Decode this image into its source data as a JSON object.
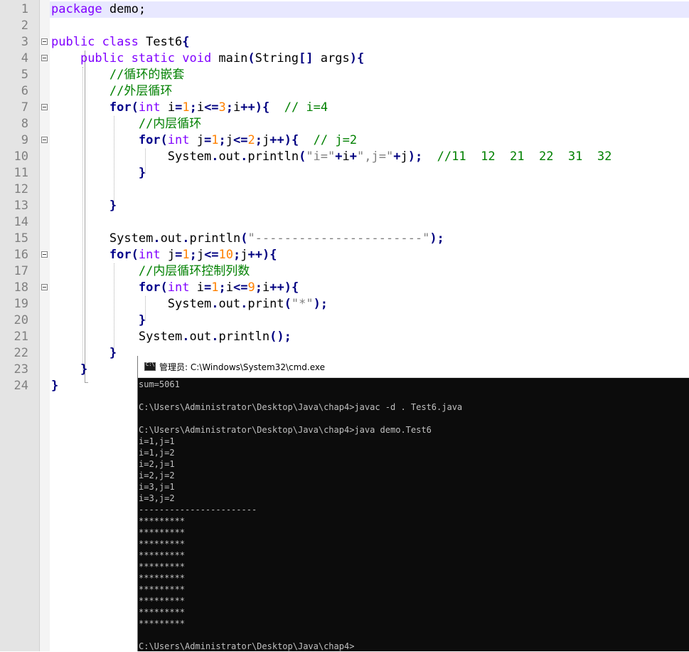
{
  "editor": {
    "lines": [
      {
        "n": "1",
        "tokens": [
          {
            "t": "package",
            "c": "kw"
          },
          {
            "t": " demo;",
            "c": "tx"
          }
        ]
      },
      {
        "n": "2",
        "tokens": []
      },
      {
        "n": "3",
        "tokens": [
          {
            "t": "public class",
            "c": "kw"
          },
          {
            "t": " Test6",
            "c": "tx"
          },
          {
            "t": "{",
            "c": "op"
          }
        ]
      },
      {
        "n": "4",
        "tokens": [
          {
            "t": "    ",
            "c": "tx"
          },
          {
            "t": "public static void",
            "c": "kw"
          },
          {
            "t": " main",
            "c": "tx"
          },
          {
            "t": "(",
            "c": "op"
          },
          {
            "t": "String",
            "c": "tx"
          },
          {
            "t": "[]",
            "c": "op"
          },
          {
            "t": " args",
            "c": "tx"
          },
          {
            "t": "){",
            "c": "op"
          }
        ]
      },
      {
        "n": "5",
        "tokens": [
          {
            "t": "        ",
            "c": "tx"
          },
          {
            "t": "//循环的嵌套",
            "c": "cm"
          }
        ]
      },
      {
        "n": "6",
        "tokens": [
          {
            "t": "        ",
            "c": "tx"
          },
          {
            "t": "//外层循环",
            "c": "cm"
          }
        ]
      },
      {
        "n": "7",
        "tokens": [
          {
            "t": "        ",
            "c": "tx"
          },
          {
            "t": "for",
            "c": "kwb"
          },
          {
            "t": "(",
            "c": "op"
          },
          {
            "t": "int",
            "c": "kw"
          },
          {
            "t": " i",
            "c": "tx"
          },
          {
            "t": "=",
            "c": "op"
          },
          {
            "t": "1",
            "c": "num"
          },
          {
            "t": ";",
            "c": "op"
          },
          {
            "t": "i",
            "c": "tx"
          },
          {
            "t": "<=",
            "c": "op"
          },
          {
            "t": "3",
            "c": "num"
          },
          {
            "t": ";",
            "c": "op"
          },
          {
            "t": "i",
            "c": "tx"
          },
          {
            "t": "++){",
            "c": "op"
          },
          {
            "t": "  ",
            "c": "tx"
          },
          {
            "t": "// i=4",
            "c": "cm"
          }
        ]
      },
      {
        "n": "8",
        "tokens": [
          {
            "t": "            ",
            "c": "tx"
          },
          {
            "t": "//内层循环",
            "c": "cm"
          }
        ]
      },
      {
        "n": "9",
        "tokens": [
          {
            "t": "            ",
            "c": "tx"
          },
          {
            "t": "for",
            "c": "kwb"
          },
          {
            "t": "(",
            "c": "op"
          },
          {
            "t": "int",
            "c": "kw"
          },
          {
            "t": " j",
            "c": "tx"
          },
          {
            "t": "=",
            "c": "op"
          },
          {
            "t": "1",
            "c": "num"
          },
          {
            "t": ";",
            "c": "op"
          },
          {
            "t": "j",
            "c": "tx"
          },
          {
            "t": "<=",
            "c": "op"
          },
          {
            "t": "2",
            "c": "num"
          },
          {
            "t": ";",
            "c": "op"
          },
          {
            "t": "j",
            "c": "tx"
          },
          {
            "t": "++){",
            "c": "op"
          },
          {
            "t": "  ",
            "c": "tx"
          },
          {
            "t": "// j=2",
            "c": "cm"
          }
        ]
      },
      {
        "n": "10",
        "tokens": [
          {
            "t": "                ",
            "c": "tx"
          },
          {
            "t": "System",
            "c": "tx"
          },
          {
            "t": ".",
            "c": "op"
          },
          {
            "t": "out",
            "c": "tx"
          },
          {
            "t": ".",
            "c": "op"
          },
          {
            "t": "println",
            "c": "tx"
          },
          {
            "t": "(",
            "c": "op"
          },
          {
            "t": "\"i=\"",
            "c": "str"
          },
          {
            "t": "+",
            "c": "op"
          },
          {
            "t": "i",
            "c": "tx"
          },
          {
            "t": "+",
            "c": "op"
          },
          {
            "t": "\",j=\"",
            "c": "str"
          },
          {
            "t": "+",
            "c": "op"
          },
          {
            "t": "j",
            "c": "tx"
          },
          {
            "t": ");",
            "c": "op"
          },
          {
            "t": "  ",
            "c": "tx"
          },
          {
            "t": "//11  12  21  22  31  32",
            "c": "cm"
          }
        ]
      },
      {
        "n": "11",
        "tokens": [
          {
            "t": "            ",
            "c": "tx"
          },
          {
            "t": "}",
            "c": "op"
          }
        ]
      },
      {
        "n": "12",
        "tokens": []
      },
      {
        "n": "13",
        "tokens": [
          {
            "t": "        ",
            "c": "tx"
          },
          {
            "t": "}",
            "c": "op"
          }
        ]
      },
      {
        "n": "14",
        "tokens": []
      },
      {
        "n": "15",
        "tokens": [
          {
            "t": "        ",
            "c": "tx"
          },
          {
            "t": "System",
            "c": "tx"
          },
          {
            "t": ".",
            "c": "op"
          },
          {
            "t": "out",
            "c": "tx"
          },
          {
            "t": ".",
            "c": "op"
          },
          {
            "t": "println",
            "c": "tx"
          },
          {
            "t": "(",
            "c": "op"
          },
          {
            "t": "\"-----------------------\"",
            "c": "str"
          },
          {
            "t": ");",
            "c": "op"
          }
        ]
      },
      {
        "n": "16",
        "tokens": [
          {
            "t": "        ",
            "c": "tx"
          },
          {
            "t": "for",
            "c": "kwb"
          },
          {
            "t": "(",
            "c": "op"
          },
          {
            "t": "int",
            "c": "kw"
          },
          {
            "t": " j",
            "c": "tx"
          },
          {
            "t": "=",
            "c": "op"
          },
          {
            "t": "1",
            "c": "num"
          },
          {
            "t": ";",
            "c": "op"
          },
          {
            "t": "j",
            "c": "tx"
          },
          {
            "t": "<=",
            "c": "op"
          },
          {
            "t": "10",
            "c": "num"
          },
          {
            "t": ";",
            "c": "op"
          },
          {
            "t": "j",
            "c": "tx"
          },
          {
            "t": "++){",
            "c": "op"
          }
        ]
      },
      {
        "n": "17",
        "tokens": [
          {
            "t": "            ",
            "c": "tx"
          },
          {
            "t": "//内层循环控制列数",
            "c": "cm"
          }
        ]
      },
      {
        "n": "18",
        "tokens": [
          {
            "t": "            ",
            "c": "tx"
          },
          {
            "t": "for",
            "c": "kwb"
          },
          {
            "t": "(",
            "c": "op"
          },
          {
            "t": "int",
            "c": "kw"
          },
          {
            "t": " i",
            "c": "tx"
          },
          {
            "t": "=",
            "c": "op"
          },
          {
            "t": "1",
            "c": "num"
          },
          {
            "t": ";",
            "c": "op"
          },
          {
            "t": "i",
            "c": "tx"
          },
          {
            "t": "<=",
            "c": "op"
          },
          {
            "t": "9",
            "c": "num"
          },
          {
            "t": ";",
            "c": "op"
          },
          {
            "t": "i",
            "c": "tx"
          },
          {
            "t": "++){",
            "c": "op"
          }
        ]
      },
      {
        "n": "19",
        "tokens": [
          {
            "t": "                ",
            "c": "tx"
          },
          {
            "t": "System",
            "c": "tx"
          },
          {
            "t": ".",
            "c": "op"
          },
          {
            "t": "out",
            "c": "tx"
          },
          {
            "t": ".",
            "c": "op"
          },
          {
            "t": "print",
            "c": "tx"
          },
          {
            "t": "(",
            "c": "op"
          },
          {
            "t": "\"*\"",
            "c": "str"
          },
          {
            "t": ");",
            "c": "op"
          }
        ]
      },
      {
        "n": "20",
        "tokens": [
          {
            "t": "            ",
            "c": "tx"
          },
          {
            "t": "}",
            "c": "op"
          }
        ]
      },
      {
        "n": "21",
        "tokens": [
          {
            "t": "            ",
            "c": "tx"
          },
          {
            "t": "System",
            "c": "tx"
          },
          {
            "t": ".",
            "c": "op"
          },
          {
            "t": "out",
            "c": "tx"
          },
          {
            "t": ".",
            "c": "op"
          },
          {
            "t": "println",
            "c": "tx"
          },
          {
            "t": "();",
            "c": "op"
          }
        ]
      },
      {
        "n": "22",
        "tokens": [
          {
            "t": "        ",
            "c": "tx"
          },
          {
            "t": "}",
            "c": "op"
          }
        ]
      },
      {
        "n": "23",
        "tokens": [
          {
            "t": "    ",
            "c": "tx"
          },
          {
            "t": "}",
            "c": "op"
          }
        ]
      },
      {
        "n": "24",
        "tokens": [
          {
            "t": "}",
            "c": "op"
          }
        ]
      }
    ],
    "fold_markers": [
      "3",
      "4",
      "7",
      "9",
      "16",
      "18"
    ]
  },
  "cmd": {
    "title": "管理员: C:\\Windows\\System32\\cmd.exe",
    "icon": "console-icon",
    "output": [
      "sum=5061",
      "",
      "C:\\Users\\Administrator\\Desktop\\Java\\chap4>javac -d . Test6.java",
      "",
      "C:\\Users\\Administrator\\Desktop\\Java\\chap4>java demo.Test6",
      "i=1,j=1",
      "i=1,j=2",
      "i=2,j=1",
      "i=2,j=2",
      "i=3,j=1",
      "i=3,j=2",
      "-----------------------",
      "*********",
      "*********",
      "*********",
      "*********",
      "*********",
      "*********",
      "*********",
      "*********",
      "*********",
      "*********",
      "",
      "C:\\Users\\Administrator\\Desktop\\Java\\chap4>"
    ]
  },
  "colors": {
    "keyword": "#8000ff",
    "control_keyword": "#00008b",
    "comment": "#008000",
    "number": "#ff8000",
    "string": "#808080",
    "operator": "#000080",
    "console_bg": "#0c0c0c",
    "console_text": "#c0c0c0"
  }
}
